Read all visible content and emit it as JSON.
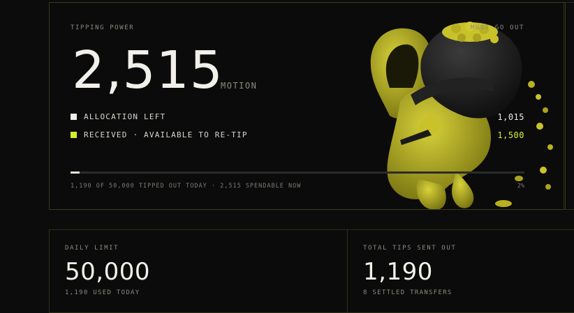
{
  "tipping": {
    "label": "TIPPING POWER",
    "badge": "MUST GO OUT",
    "amount": "2,515",
    "unit": "MOTION",
    "rows": [
      {
        "label": "ALLOCATION LEFT",
        "value": "1,015",
        "color": "#f0eee8"
      },
      {
        "label": "RECEIVED · AVAILABLE TO RE-TIP",
        "value": "1,500",
        "color": "#d4ef2b"
      }
    ],
    "progress": {
      "fraction": 0.02,
      "caption": "1,190 OF 50,000 TIPPED OUT TODAY · 2,515 SPENDABLE NOW",
      "percent_label": "2%"
    }
  },
  "stats": [
    {
      "label": "DAILY LIMIT",
      "value": "50,000",
      "sub": "1,190 USED TODAY"
    },
    {
      "label": "TOTAL TIPS SENT OUT",
      "value": "1,190",
      "sub": "8 SETTLED TRANSFERS"
    }
  ],
  "colors": {
    "accent": "#d4ef2b",
    "mascot": "#c9c22a",
    "border": "#39391a",
    "background": "#0c0c0d"
  }
}
